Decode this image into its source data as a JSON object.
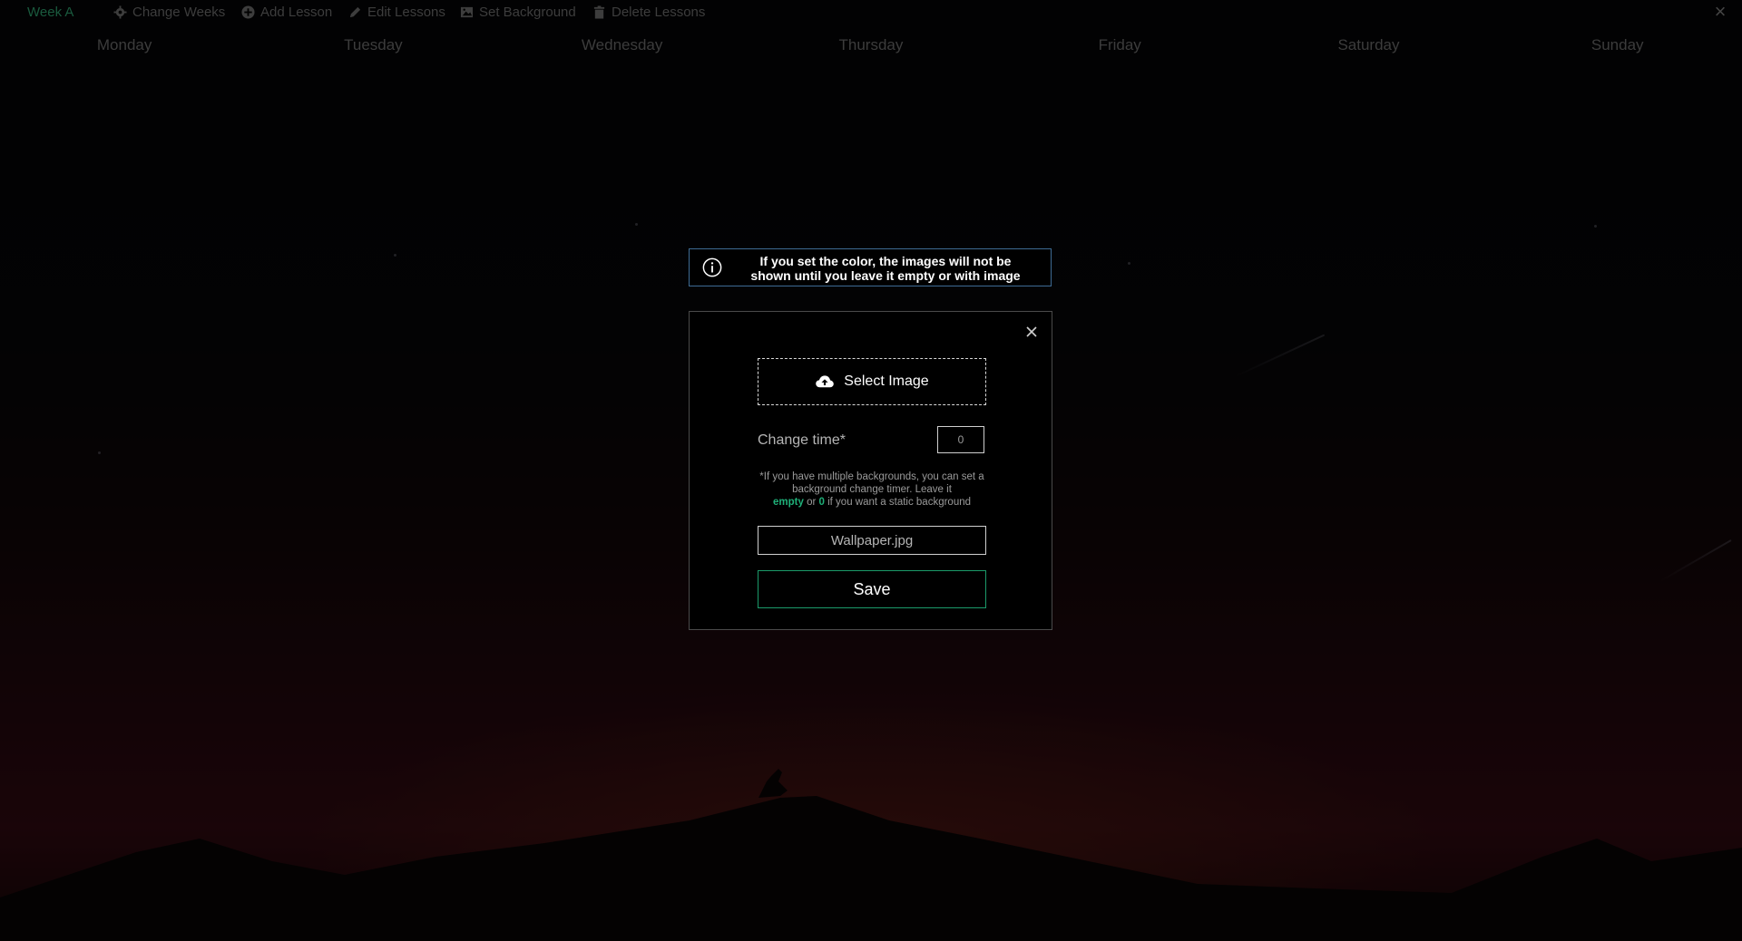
{
  "toolbar": {
    "week_label": "Week A",
    "items": [
      {
        "label": "Change Weeks",
        "icon": "gear-icon"
      },
      {
        "label": "Add Lesson",
        "icon": "plus-circle-icon"
      },
      {
        "label": "Edit Lessons",
        "icon": "pencil-icon"
      },
      {
        "label": "Set Background",
        "icon": "image-icon"
      },
      {
        "label": "Delete Lessons",
        "icon": "trash-icon"
      }
    ],
    "close_glyph": "×"
  },
  "days": [
    "Monday",
    "Tuesday",
    "Wednesday",
    "Thursday",
    "Friday",
    "Saturday",
    "Sunday"
  ],
  "info": {
    "line1": "If you set the color, the images will not be",
    "line2": "shown until you leave it empty or with image"
  },
  "modal": {
    "select_image_label": "Select Image",
    "change_time_label": "Change time*",
    "change_time_value": "0",
    "hint": {
      "part1": "*If you have multiple backgrounds, you can set a background change timer. Leave it",
      "empty_word": "empty",
      "or_word": "or",
      "zero_word": "0",
      "part2": "if you want a static background"
    },
    "filename": "Wallpaper.jpg",
    "save_label": "Save"
  },
  "colors": {
    "accent_green": "#1fb079",
    "info_border": "#3e6b94"
  }
}
